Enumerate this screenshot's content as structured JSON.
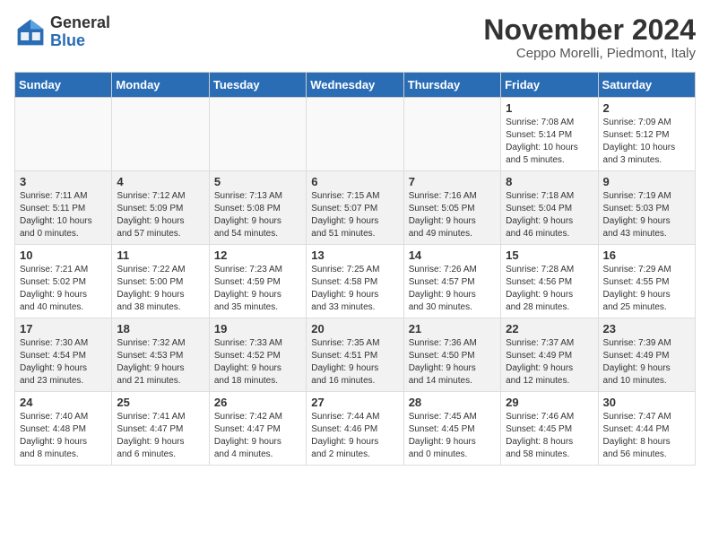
{
  "logo": {
    "general": "General",
    "blue": "Blue"
  },
  "title": "November 2024",
  "location": "Ceppo Morelli, Piedmont, Italy",
  "headers": [
    "Sunday",
    "Monday",
    "Tuesday",
    "Wednesday",
    "Thursday",
    "Friday",
    "Saturday"
  ],
  "weeks": [
    [
      {
        "day": "",
        "info": ""
      },
      {
        "day": "",
        "info": ""
      },
      {
        "day": "",
        "info": ""
      },
      {
        "day": "",
        "info": ""
      },
      {
        "day": "",
        "info": ""
      },
      {
        "day": "1",
        "info": "Sunrise: 7:08 AM\nSunset: 5:14 PM\nDaylight: 10 hours\nand 5 minutes."
      },
      {
        "day": "2",
        "info": "Sunrise: 7:09 AM\nSunset: 5:12 PM\nDaylight: 10 hours\nand 3 minutes."
      }
    ],
    [
      {
        "day": "3",
        "info": "Sunrise: 7:11 AM\nSunset: 5:11 PM\nDaylight: 10 hours\nand 0 minutes."
      },
      {
        "day": "4",
        "info": "Sunrise: 7:12 AM\nSunset: 5:09 PM\nDaylight: 9 hours\nand 57 minutes."
      },
      {
        "day": "5",
        "info": "Sunrise: 7:13 AM\nSunset: 5:08 PM\nDaylight: 9 hours\nand 54 minutes."
      },
      {
        "day": "6",
        "info": "Sunrise: 7:15 AM\nSunset: 5:07 PM\nDaylight: 9 hours\nand 51 minutes."
      },
      {
        "day": "7",
        "info": "Sunrise: 7:16 AM\nSunset: 5:05 PM\nDaylight: 9 hours\nand 49 minutes."
      },
      {
        "day": "8",
        "info": "Sunrise: 7:18 AM\nSunset: 5:04 PM\nDaylight: 9 hours\nand 46 minutes."
      },
      {
        "day": "9",
        "info": "Sunrise: 7:19 AM\nSunset: 5:03 PM\nDaylight: 9 hours\nand 43 minutes."
      }
    ],
    [
      {
        "day": "10",
        "info": "Sunrise: 7:21 AM\nSunset: 5:02 PM\nDaylight: 9 hours\nand 40 minutes."
      },
      {
        "day": "11",
        "info": "Sunrise: 7:22 AM\nSunset: 5:00 PM\nDaylight: 9 hours\nand 38 minutes."
      },
      {
        "day": "12",
        "info": "Sunrise: 7:23 AM\nSunset: 4:59 PM\nDaylight: 9 hours\nand 35 minutes."
      },
      {
        "day": "13",
        "info": "Sunrise: 7:25 AM\nSunset: 4:58 PM\nDaylight: 9 hours\nand 33 minutes."
      },
      {
        "day": "14",
        "info": "Sunrise: 7:26 AM\nSunset: 4:57 PM\nDaylight: 9 hours\nand 30 minutes."
      },
      {
        "day": "15",
        "info": "Sunrise: 7:28 AM\nSunset: 4:56 PM\nDaylight: 9 hours\nand 28 minutes."
      },
      {
        "day": "16",
        "info": "Sunrise: 7:29 AM\nSunset: 4:55 PM\nDaylight: 9 hours\nand 25 minutes."
      }
    ],
    [
      {
        "day": "17",
        "info": "Sunrise: 7:30 AM\nSunset: 4:54 PM\nDaylight: 9 hours\nand 23 minutes."
      },
      {
        "day": "18",
        "info": "Sunrise: 7:32 AM\nSunset: 4:53 PM\nDaylight: 9 hours\nand 21 minutes."
      },
      {
        "day": "19",
        "info": "Sunrise: 7:33 AM\nSunset: 4:52 PM\nDaylight: 9 hours\nand 18 minutes."
      },
      {
        "day": "20",
        "info": "Sunrise: 7:35 AM\nSunset: 4:51 PM\nDaylight: 9 hours\nand 16 minutes."
      },
      {
        "day": "21",
        "info": "Sunrise: 7:36 AM\nSunset: 4:50 PM\nDaylight: 9 hours\nand 14 minutes."
      },
      {
        "day": "22",
        "info": "Sunrise: 7:37 AM\nSunset: 4:49 PM\nDaylight: 9 hours\nand 12 minutes."
      },
      {
        "day": "23",
        "info": "Sunrise: 7:39 AM\nSunset: 4:49 PM\nDaylight: 9 hours\nand 10 minutes."
      }
    ],
    [
      {
        "day": "24",
        "info": "Sunrise: 7:40 AM\nSunset: 4:48 PM\nDaylight: 9 hours\nand 8 minutes."
      },
      {
        "day": "25",
        "info": "Sunrise: 7:41 AM\nSunset: 4:47 PM\nDaylight: 9 hours\nand 6 minutes."
      },
      {
        "day": "26",
        "info": "Sunrise: 7:42 AM\nSunset: 4:47 PM\nDaylight: 9 hours\nand 4 minutes."
      },
      {
        "day": "27",
        "info": "Sunrise: 7:44 AM\nSunset: 4:46 PM\nDaylight: 9 hours\nand 2 minutes."
      },
      {
        "day": "28",
        "info": "Sunrise: 7:45 AM\nSunset: 4:45 PM\nDaylight: 9 hours\nand 0 minutes."
      },
      {
        "day": "29",
        "info": "Sunrise: 7:46 AM\nSunset: 4:45 PM\nDaylight: 8 hours\nand 58 minutes."
      },
      {
        "day": "30",
        "info": "Sunrise: 7:47 AM\nSunset: 4:44 PM\nDaylight: 8 hours\nand 56 minutes."
      }
    ]
  ]
}
